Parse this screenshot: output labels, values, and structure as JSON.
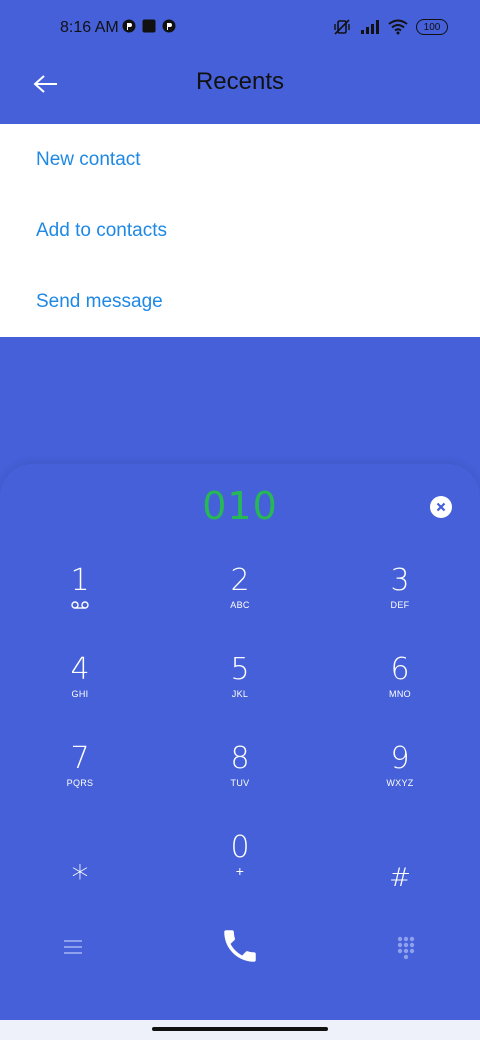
{
  "status_bar": {
    "time": "8:16 AM",
    "battery": "100"
  },
  "header": {
    "title": "Recents",
    "back_icon": "arrow-left-icon"
  },
  "menu": {
    "items": [
      {
        "label": "New contact"
      },
      {
        "label": "Add to contacts"
      },
      {
        "label": "Send message"
      }
    ]
  },
  "dialer": {
    "number": "010",
    "keys": [
      {
        "digit": "1",
        "letters": ""
      },
      {
        "digit": "2",
        "letters": "ABC"
      },
      {
        "digit": "3",
        "letters": "DEF"
      },
      {
        "digit": "4",
        "letters": "GHI"
      },
      {
        "digit": "5",
        "letters": "JKL"
      },
      {
        "digit": "6",
        "letters": "MNO"
      },
      {
        "digit": "7",
        "letters": "PQRS"
      },
      {
        "digit": "8",
        "letters": "TUV"
      },
      {
        "digit": "9",
        "letters": "WXYZ"
      },
      {
        "digit": "*",
        "letters": ""
      },
      {
        "digit": "0",
        "letters": "+"
      },
      {
        "digit": "#",
        "letters": ""
      }
    ]
  },
  "colors": {
    "background": "#4560d8",
    "menu_text": "#1e88e5",
    "number": "#27b856"
  }
}
